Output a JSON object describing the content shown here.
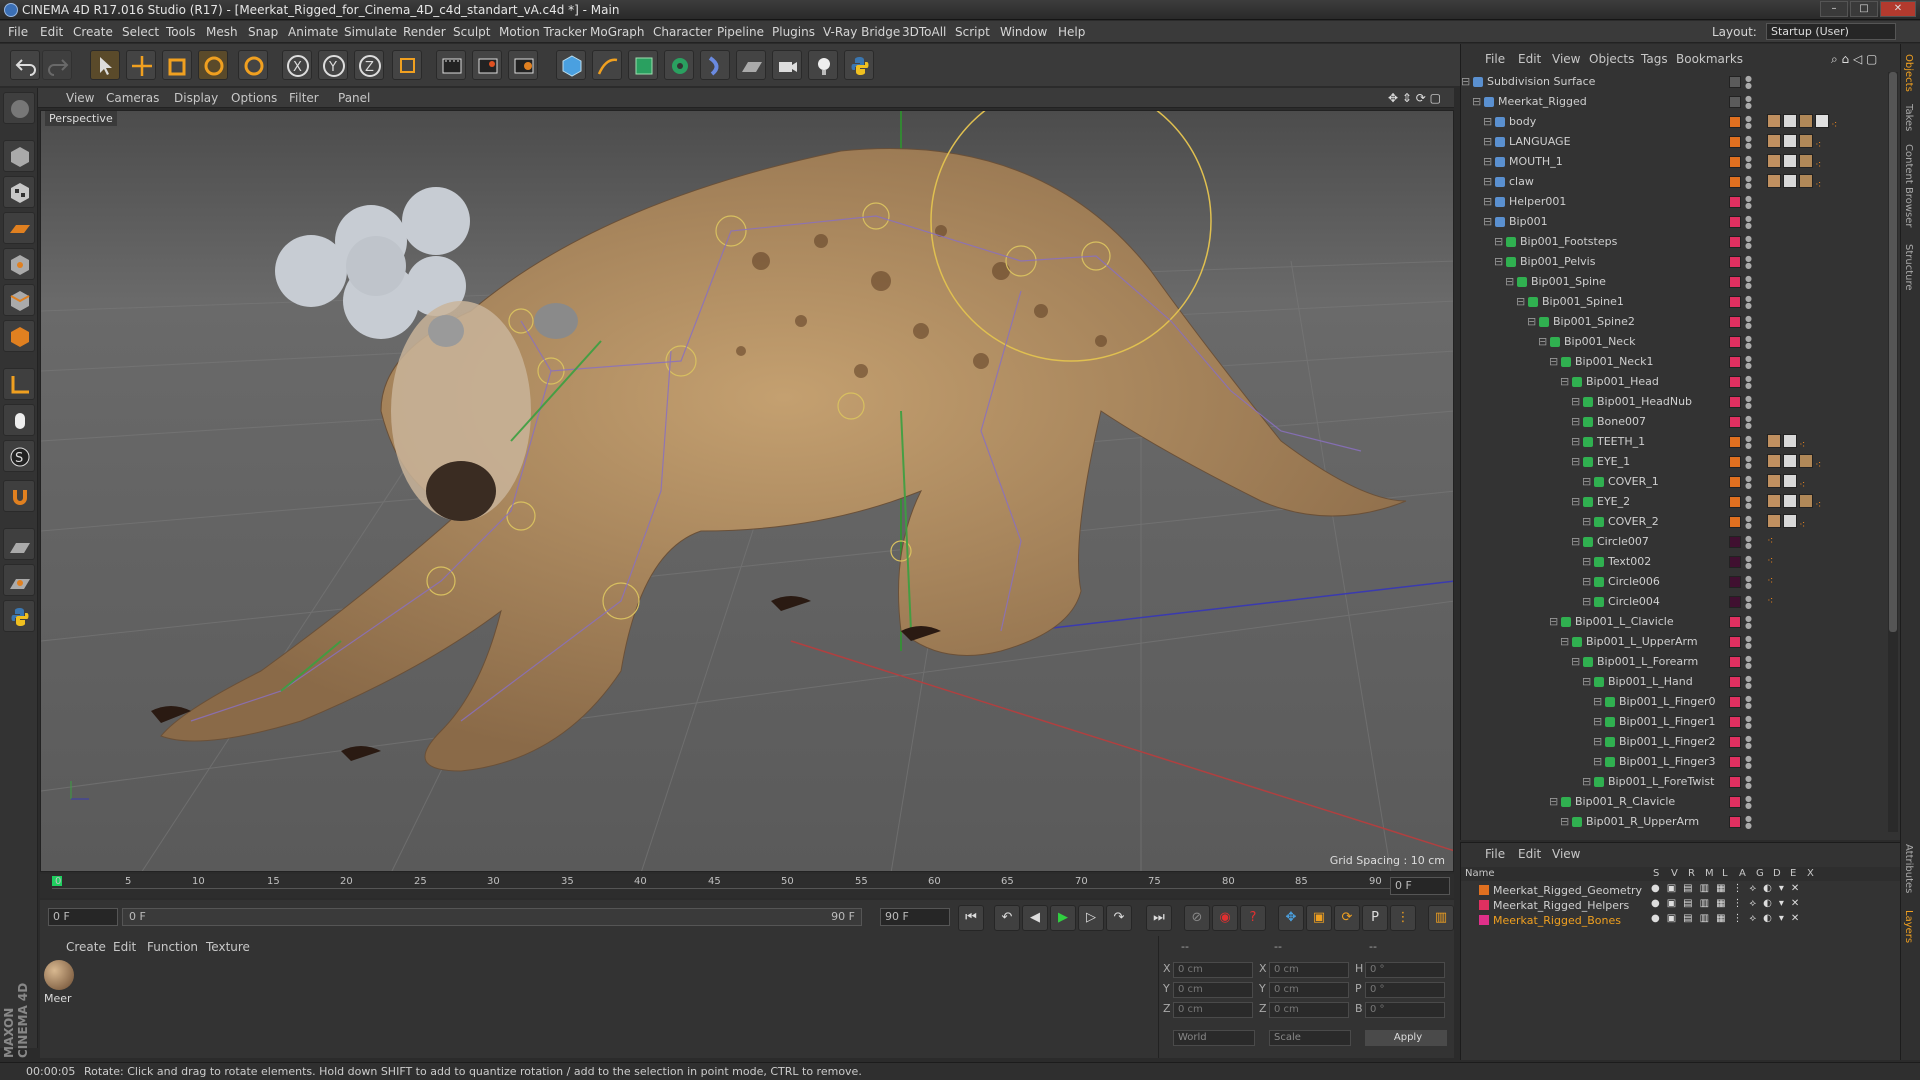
{
  "window": {
    "title": "CINEMA 4D R17.016 Studio (R17) - [Meerkat_Rigged_for_Cinema_4D_c4d_standart_vA.c4d *] - Main"
  },
  "menubar": {
    "items": [
      "File",
      "Edit",
      "Create",
      "Select",
      "Tools",
      "Mesh",
      "Snap",
      "Animate",
      "Simulate",
      "Render",
      "Sculpt",
      "Motion Tracker",
      "MoGraph",
      "Character",
      "Pipeline",
      "Plugins",
      "V-Ray Bridge",
      "3DToAll",
      "Script",
      "Window",
      "Help"
    ],
    "layout_label": "Layout:",
    "layout_value": "Startup (User)"
  },
  "viewport": {
    "menu": [
      "View",
      "Cameras",
      "Display",
      "Options",
      "Filter",
      "Panel"
    ],
    "label": "Perspective",
    "grid_spacing": "Grid Spacing : 10 cm"
  },
  "timeline": {
    "ticks": [
      "0",
      "5",
      "10",
      "15",
      "20",
      "25",
      "30",
      "35",
      "40",
      "45",
      "50",
      "55",
      "60",
      "65",
      "70",
      "75",
      "80",
      "85",
      "90"
    ],
    "end_field": "0 F"
  },
  "transport": {
    "start_field": "0 F",
    "range_start": "0 F",
    "range_end": "90 F",
    "end_field": "90 F"
  },
  "material_panel": {
    "menu": [
      "Create",
      "Edit",
      "Function",
      "Texture"
    ],
    "material_name": "Meer"
  },
  "coords": {
    "header": [
      "--",
      "--",
      "--"
    ],
    "rows": [
      {
        "axis": "X",
        "pos": "0 cm",
        "axis2": "X",
        "size": "0 cm",
        "rot_lbl": "H",
        "rot": "0 °"
      },
      {
        "axis": "Y",
        "pos": "0 cm",
        "axis2": "Y",
        "size": "0 cm",
        "rot_lbl": "P",
        "rot": "0 °"
      },
      {
        "axis": "Z",
        "pos": "0 cm",
        "axis2": "Z",
        "size": "0 cm",
        "rot_lbl": "B",
        "rot": "0 °"
      }
    ],
    "world": "World",
    "scale": "Scale",
    "apply": "Apply"
  },
  "object_manager": {
    "menu": [
      "File",
      "Edit",
      "View",
      "Objects",
      "Tags",
      "Bookmarks"
    ],
    "objects": [
      {
        "name": "Subdivision Surface",
        "depth": 0,
        "color": "#5b5b5b",
        "tags": 0
      },
      {
        "name": "Meerkat_Rigged",
        "depth": 1,
        "color": "#5b5b5b",
        "tags": 0
      },
      {
        "name": "body",
        "depth": 2,
        "color": "#e07020",
        "tags": 5
      },
      {
        "name": "LANGUAGE",
        "depth": 2,
        "color": "#e07020",
        "tags": 4
      },
      {
        "name": "MOUTH_1",
        "depth": 2,
        "color": "#e07020",
        "tags": 4
      },
      {
        "name": "claw",
        "depth": 2,
        "color": "#e07020",
        "tags": 4
      },
      {
        "name": "Helper001",
        "depth": 2,
        "color": "#e03060",
        "tags": 0
      },
      {
        "name": "Bip001",
        "depth": 2,
        "color": "#e03060",
        "tags": 0
      },
      {
        "name": "Bip001_Footsteps",
        "depth": 3,
        "color": "#e03060",
        "tags": 0
      },
      {
        "name": "Bip001_Pelvis",
        "depth": 3,
        "color": "#e03060",
        "tags": 0
      },
      {
        "name": "Bip001_Spine",
        "depth": 4,
        "color": "#e03060",
        "tags": 0
      },
      {
        "name": "Bip001_Spine1",
        "depth": 5,
        "color": "#e03060",
        "tags": 0
      },
      {
        "name": "Bip001_Spine2",
        "depth": 6,
        "color": "#e03060",
        "tags": 0
      },
      {
        "name": "Bip001_Neck",
        "depth": 7,
        "color": "#e03060",
        "tags": 0
      },
      {
        "name": "Bip001_Neck1",
        "depth": 8,
        "color": "#e03060",
        "tags": 0
      },
      {
        "name": "Bip001_Head",
        "depth": 9,
        "color": "#e03060",
        "tags": 0
      },
      {
        "name": "Bip001_HeadNub",
        "depth": 10,
        "color": "#e03060",
        "tags": 0
      },
      {
        "name": "Bone007",
        "depth": 10,
        "color": "#e03060",
        "tags": 0
      },
      {
        "name": "TEETH_1",
        "depth": 10,
        "color": "#e07020",
        "tags": 3
      },
      {
        "name": "EYE_1",
        "depth": 10,
        "color": "#e07020",
        "tags": 4
      },
      {
        "name": "COVER_1",
        "depth": 11,
        "color": "#e07020",
        "tags": 3
      },
      {
        "name": "EYE_2",
        "depth": 10,
        "color": "#e07020",
        "tags": 4
      },
      {
        "name": "COVER_2",
        "depth": 11,
        "color": "#e07020",
        "tags": 3
      },
      {
        "name": "Circle007",
        "depth": 10,
        "color": "#401030",
        "tags": 1
      },
      {
        "name": "Text002",
        "depth": 11,
        "color": "#401030",
        "tags": 1
      },
      {
        "name": "Circle006",
        "depth": 11,
        "color": "#401030",
        "tags": 1
      },
      {
        "name": "Circle004",
        "depth": 11,
        "color": "#401030",
        "tags": 1
      },
      {
        "name": "Bip001_L_Clavicle",
        "depth": 8,
        "color": "#e03060",
        "tags": 0
      },
      {
        "name": "Bip001_L_UpperArm",
        "depth": 9,
        "color": "#e03060",
        "tags": 0
      },
      {
        "name": "Bip001_L_Forearm",
        "depth": 10,
        "color": "#e03060",
        "tags": 0
      },
      {
        "name": "Bip001_L_Hand",
        "depth": 11,
        "color": "#e03060",
        "tags": 0
      },
      {
        "name": "Bip001_L_Finger0",
        "depth": 12,
        "color": "#e03060",
        "tags": 0
      },
      {
        "name": "Bip001_L_Finger1",
        "depth": 12,
        "color": "#e03060",
        "tags": 0
      },
      {
        "name": "Bip001_L_Finger2",
        "depth": 12,
        "color": "#e03060",
        "tags": 0
      },
      {
        "name": "Bip001_L_Finger3",
        "depth": 12,
        "color": "#e03060",
        "tags": 0
      },
      {
        "name": "Bip001_L_ForeTwist",
        "depth": 11,
        "color": "#e03060",
        "tags": 0
      },
      {
        "name": "Bip001_R_Clavicle",
        "depth": 8,
        "color": "#e03060",
        "tags": 0
      },
      {
        "name": "Bip001_R_UpperArm",
        "depth": 9,
        "color": "#e03060",
        "tags": 0
      }
    ]
  },
  "layer_manager": {
    "menu": [
      "File",
      "Edit",
      "View"
    ],
    "columns": [
      "Name",
      "S",
      "V",
      "R",
      "M",
      "L",
      "A",
      "G",
      "D",
      "E",
      "X"
    ],
    "layers": [
      {
        "name": "Meerkat_Rigged_Geometry",
        "color": "#e07020",
        "text_color": "#cfcfcf"
      },
      {
        "name": "Meerkat_Rigged_Helpers",
        "color": "#e03060",
        "text_color": "#cfcfcf"
      },
      {
        "name": "Meerkat_Rigged_Bones",
        "color": "#e0308a",
        "text_color": "#f0a020"
      }
    ]
  },
  "right_tabs": [
    "Objects",
    "Takes",
    "Content Browser",
    "Structure",
    "Attributes",
    "Layers"
  ],
  "status": {
    "time": "00:00:05",
    "message": "Rotate: Click and drag to rotate elements. Hold down SHIFT to add to quantize rotation / add to the selection in point mode, CTRL to remove."
  },
  "brand": "MAXON CINEMA 4D"
}
